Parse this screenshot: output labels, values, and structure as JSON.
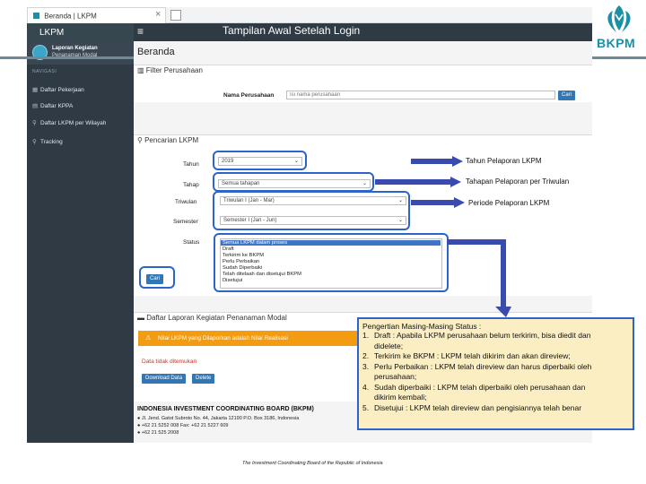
{
  "slide": {
    "title": "Tampilan Awal Setelah Login",
    "logo_text": "BKPM",
    "footer": "The Investment Coordinating Board of the Republic of Indonesia"
  },
  "browser": {
    "tab_title": "Beranda | LKPM",
    "tab_close": "×"
  },
  "app": {
    "brand": "LKPM",
    "sidebar": {
      "user_line1": "Laporan Kegiatan",
      "user_line2": "Penanaman Modal",
      "nav_heading": "NAVIGASI",
      "items": [
        {
          "label": "Daftar Pekerjaan",
          "icon": "▦"
        },
        {
          "label": "Daftar KPPA",
          "icon": "▤"
        },
        {
          "label": "Daftar LKPM per Wilayah",
          "icon": "⚲"
        },
        {
          "label": "Tracking",
          "icon": "⚲"
        }
      ]
    },
    "topnav": {
      "menu_icon": "≡"
    },
    "page_title": "Beranda",
    "filter_panel": {
      "heading": "Filter Perusahaan",
      "label": "Nama Perusahaan",
      "placeholder": "Isi nama perusahaan",
      "button": "Cari"
    },
    "search_panel": {
      "heading": "Pencarian LKPM",
      "tahun_label": "Tahun",
      "tahun_value": "2019",
      "tahap_label": "Tahap",
      "tahap_value": "Semua tahapan",
      "triwulan_label": "Triwulan",
      "triwulan_value": "Triwulan I (Jan - Mar)",
      "semester_label": "Semester",
      "semester_value": "Semester I (Jan - Jun)",
      "status_label": "Status",
      "status_options": [
        "Semua LKPM dalam proses",
        "Draft",
        "Terkirim ke BKPM",
        "Perlu Perbaikan",
        "Sudah Diperbaiki",
        "Telah ditelaah dan disetujui BKPM",
        "Disetujui"
      ],
      "button": "Cari"
    },
    "list_panel": {
      "heading": "Daftar Laporan Kegiatan Penanaman Modal",
      "warning": "Nilai LKPM yang Dilaporkan adalah Nilai Realisasi",
      "no_data": "Data tidak ditemukan",
      "download_button": "Download Data",
      "delete_button": "Delete"
    },
    "footer": {
      "heading": "INDONESIA INVESTMENT COORDINATING BOARD (BKPM)",
      "lines": [
        "● Jl. Jend. Gatot Subroto No. 44, Jakarta 12190 P.O. Box 3186, Indonesia",
        "● +62 21 5252 008   Fax: +62 21 5227 609",
        "● +62 21 525 2008"
      ]
    }
  },
  "annotations": {
    "tahun_callout": "Tahun Pelaporan LKPM",
    "tahap_callout": "Tahapan Pelaporan per Triwulan",
    "periode_callout": "Periode Pelaporan LKPM",
    "status_box": {
      "title": "Pengertian Masing-Masing Status :",
      "items": [
        {
          "num": "1.",
          "text": "Draft : Apabila LKPM perusahaan belum terkirim, bisa diedit dan"
        },
        {
          "num": "",
          "text": "didelete;"
        },
        {
          "num": "2.",
          "text": "Terkirim ke BKPM : LKPM telah dikirim dan akan direview;"
        },
        {
          "num": "3.",
          "text": "Perlu Perbaikan : LKPM telah direview dan harus diperbaiki oleh"
        },
        {
          "num": "",
          "text": "perusahaan;"
        },
        {
          "num": "4.",
          "text": "Sudah diperbaiki : LKPM telah diperbaiki oleh perusahaan dan"
        },
        {
          "num": "",
          "text": "dikirim kembali;"
        },
        {
          "num": "5.",
          "text": "Disetujui : LKPM telah direview dan pengisiannya telah benar"
        }
      ]
    }
  },
  "colors": {
    "sidebar": "#2f3a44",
    "highlight": "#2e63c9",
    "callout_arrow": "#3a4bb0",
    "status_box_bg": "#fbeec2",
    "warning": "#f39c12",
    "primary_button": "#3277b5"
  }
}
